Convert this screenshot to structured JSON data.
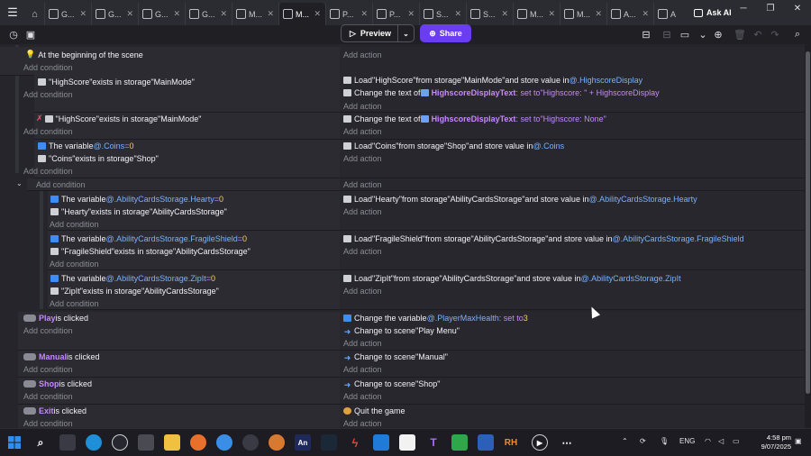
{
  "tabs": [
    {
      "label": "G...",
      "active": false
    },
    {
      "label": "G...",
      "active": false
    },
    {
      "label": "G...",
      "active": false
    },
    {
      "label": "G...",
      "active": false
    },
    {
      "label": "M...",
      "active": false
    },
    {
      "label": "M...",
      "active": true
    },
    {
      "label": "P...",
      "active": false
    },
    {
      "label": "P...",
      "active": false
    },
    {
      "label": "S...",
      "active": false
    },
    {
      "label": "S...",
      "active": false
    },
    {
      "label": "M...",
      "active": false
    },
    {
      "label": "M...",
      "active": false
    },
    {
      "label": "A...",
      "active": false
    },
    {
      "label": "A",
      "active": false
    }
  ],
  "header": {
    "ask_ai": "Ask AI",
    "preview": "Preview",
    "share": "Share"
  },
  "common": {
    "add_condition": "Add condition",
    "add_action": "Add action"
  },
  "events": {
    "e1": {
      "cond": "At the beginning of the scene"
    },
    "e2": {
      "c1": {
        "a": "\"HighScore\"",
        "b": " exists in storage ",
        "c": "\"MainMode\""
      },
      "a1": {
        "a": "Load ",
        "b": "\"HighScore\"",
        "c": " from storage ",
        "d": "\"MainMode\"",
        "e": " and store value in ",
        "f": "@.HighscoreDisplay"
      },
      "a2": {
        "a": "Change the text of ",
        "b": "HighscoreDisplayText",
        "c": ": set to ",
        "d": "\"Highscore: \" + HighscoreDisplay"
      }
    },
    "e3": {
      "c1": {
        "a": "\"HighScore\"",
        "b": " exists in storage ",
        "c": "\"MainMode\""
      },
      "a1": {
        "a": "Change the text of ",
        "b": "HighscoreDisplayText",
        "c": ": set to ",
        "d": "\"Highscore: None\""
      }
    },
    "e4": {
      "c1": {
        "a": "The variable ",
        "b": "@.Coins",
        "c": " = ",
        "d": "0"
      },
      "c2": {
        "a": "\"Coins\"",
        "b": " exists in storage ",
        "c": "\"Shop\""
      },
      "a1": {
        "a": "Load ",
        "b": "\"Coins\"",
        "c": " from storage ",
        "d": "\"Shop\"",
        "e": " and store value in ",
        "f": "@.Coins"
      }
    },
    "e6": {
      "c1": {
        "a": "The variable ",
        "b": "@.AbilityCardsStorage.Hearty",
        "c": " = ",
        "d": "0"
      },
      "c2": {
        "a": "\"Hearty\"",
        "b": " exists in storage ",
        "c": "\"AbilityCardsStorage\""
      },
      "a1": {
        "a": "Load ",
        "b": "\"Hearty\"",
        "c": " from storage ",
        "d": "\"AbilityCardsStorage\"",
        "e": " and store value in ",
        "f": "@.AbilityCardsStorage.Hearty"
      }
    },
    "e7": {
      "c1": {
        "a": "The variable ",
        "b": "@.AbilityCardsStorage.FragileShield",
        "c": " = ",
        "d": "0"
      },
      "c2": {
        "a": "\"FragileShield\"",
        "b": " exists in storage ",
        "c": "\"AbilityCardsStorage\""
      },
      "a1": {
        "a": "Load ",
        "b": "\"FragileShield\"",
        "c": " from storage ",
        "d": "\"AbilityCardsStorage\"",
        "e": " and store value in ",
        "f": "@.AbilityCardsStorage.FragileShield"
      }
    },
    "e8": {
      "c1": {
        "a": "The variable ",
        "b": "@.AbilityCardsStorage.ZipIt",
        "c": " = ",
        "d": "0"
      },
      "c2": {
        "a": "\"ZipIt\"",
        "b": " exists in storage ",
        "c": "\"AbilityCardsStorage\""
      },
      "a1": {
        "a": "Load ",
        "b": "\"ZipIt\"",
        "c": " from storage ",
        "d": "\"AbilityCardsStorage\"",
        "e": " and store value in ",
        "f": "@.AbilityCardsStorage.ZipIt"
      }
    },
    "e9": {
      "c1": {
        "a": "Play",
        "b": " is clicked"
      },
      "a1": {
        "a": "Change the variable ",
        "b": "@.PlayerMaxHealth",
        "c": ": set to ",
        "d": "3"
      },
      "a2": {
        "a": "Change to scene ",
        "b": "\"Play Menu\""
      }
    },
    "e10": {
      "c1": {
        "a": "Manual",
        "b": " is clicked"
      },
      "a1": {
        "a": "Change to scene ",
        "b": "\"Manual\""
      }
    },
    "e11": {
      "c1": {
        "a": "Shop",
        "b": " is clicked"
      },
      "a1": {
        "a": "Change to scene ",
        "b": "\"Shop\""
      }
    },
    "e12": {
      "c1": {
        "a": "Exit",
        "b": " is clicked"
      },
      "a1": {
        "a": "Quit the game"
      }
    }
  },
  "taskbar": {
    "lang": "ENG",
    "time": "4:58 pm",
    "date": "9/07/2025",
    "app_an": "An",
    "app_rh": "RH"
  },
  "colors": {
    "accent": "#6b3df0",
    "variable": "#79b3ff",
    "object": "#c788ff",
    "number": "#f1d262"
  }
}
